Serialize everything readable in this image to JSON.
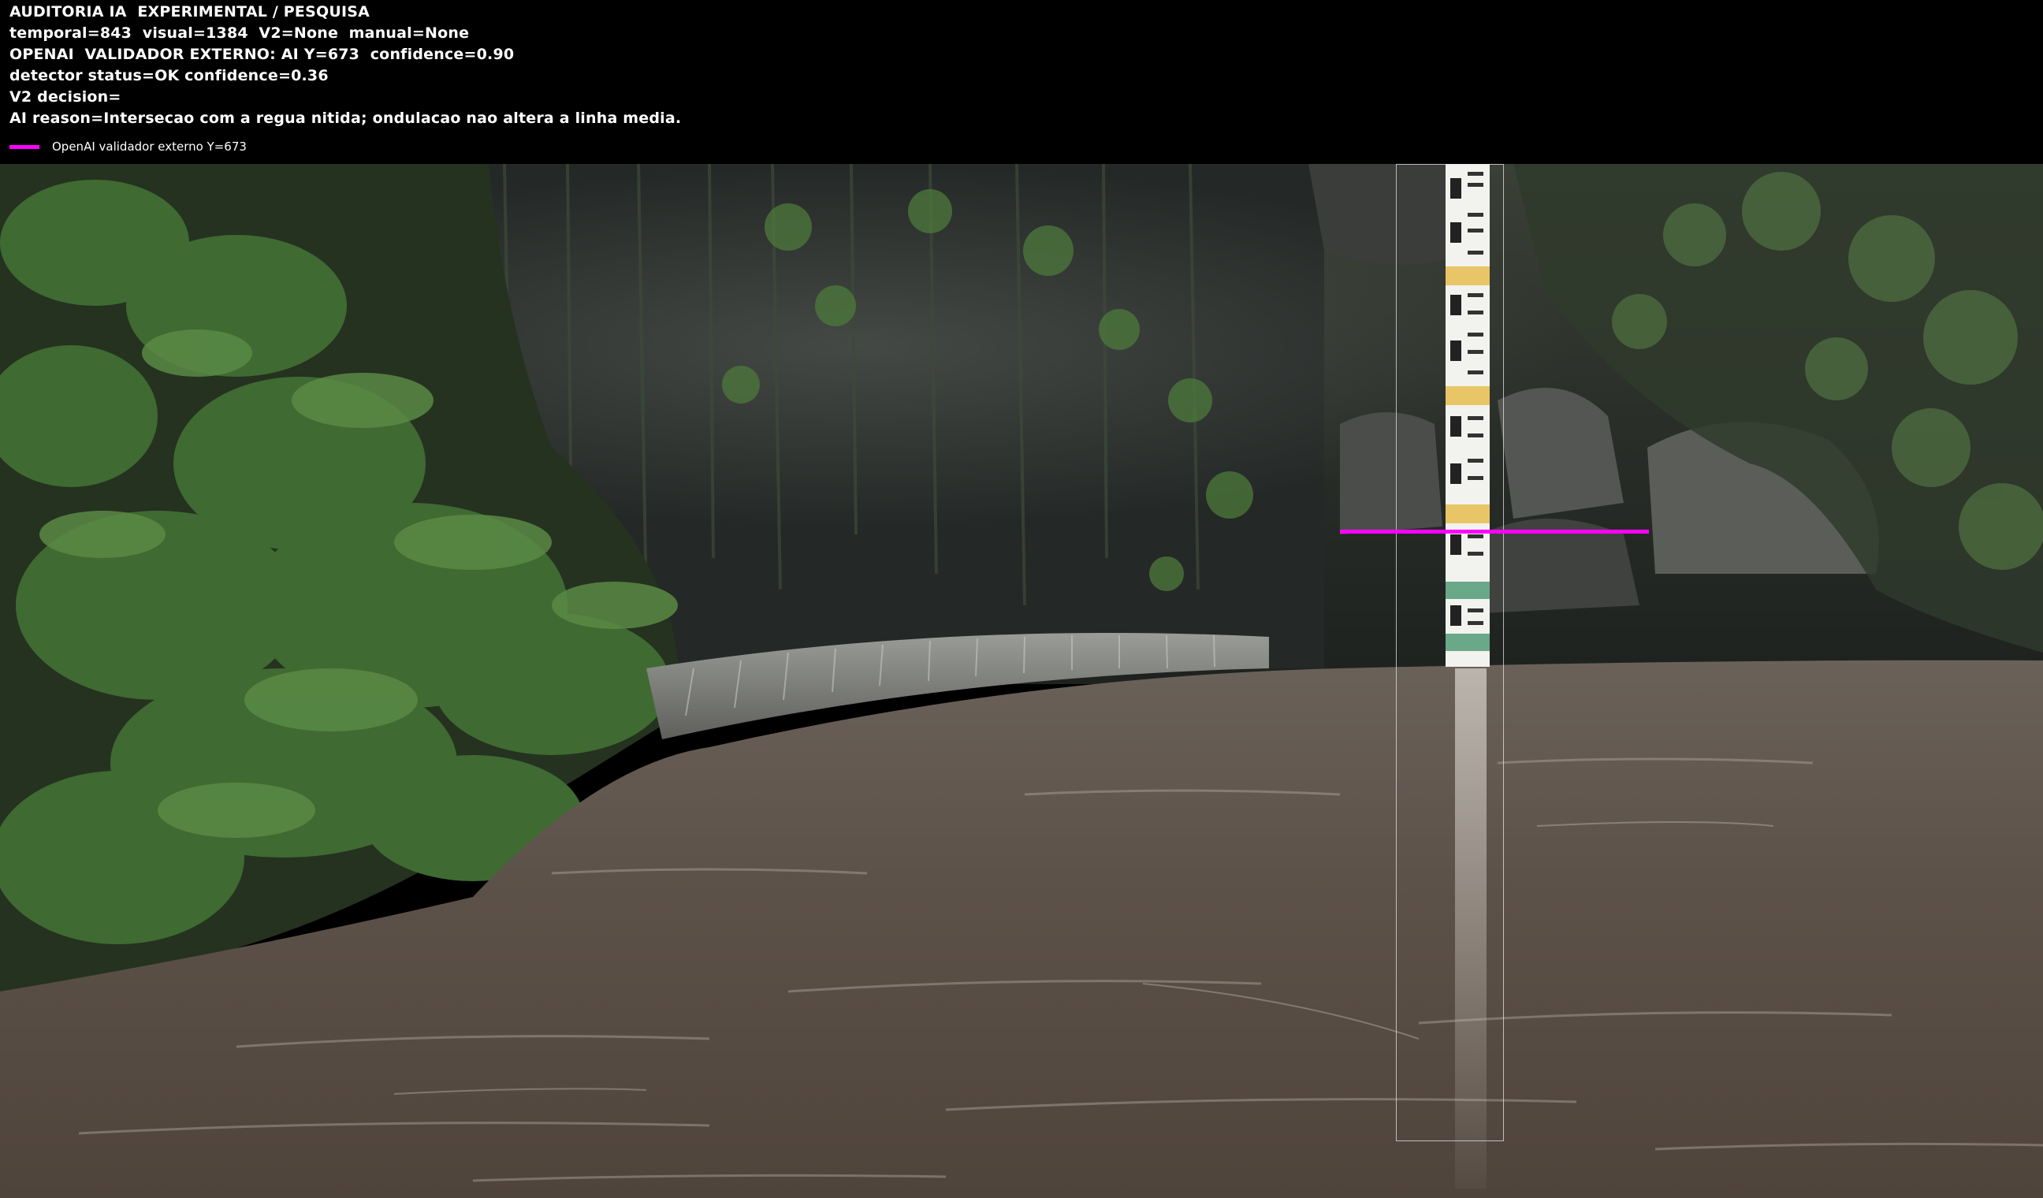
{
  "header": {
    "line1": "AUDITORIA IA  EXPERIMENTAL / PESQUISA",
    "line2": "temporal=843  visual=1384  V2=None  manual=None",
    "line3": "OPENAI  VALIDADOR EXTERNO: AI Y=673  confidence=0.90",
    "line4": "detector status=OK confidence=0.36",
    "line5": "V2 decision=",
    "line6": "AI reason=Intersecao com a regua nitida; ondulacao nao altera a linha media."
  },
  "legend": {
    "label": "OpenAI validador externo Y=673",
    "color": "#ff00ff"
  },
  "scene": {
    "description_icon": "river-gauge-photo",
    "water_level_line_color": "#ff00ff",
    "roi_box_color": "#e6e6e6"
  }
}
